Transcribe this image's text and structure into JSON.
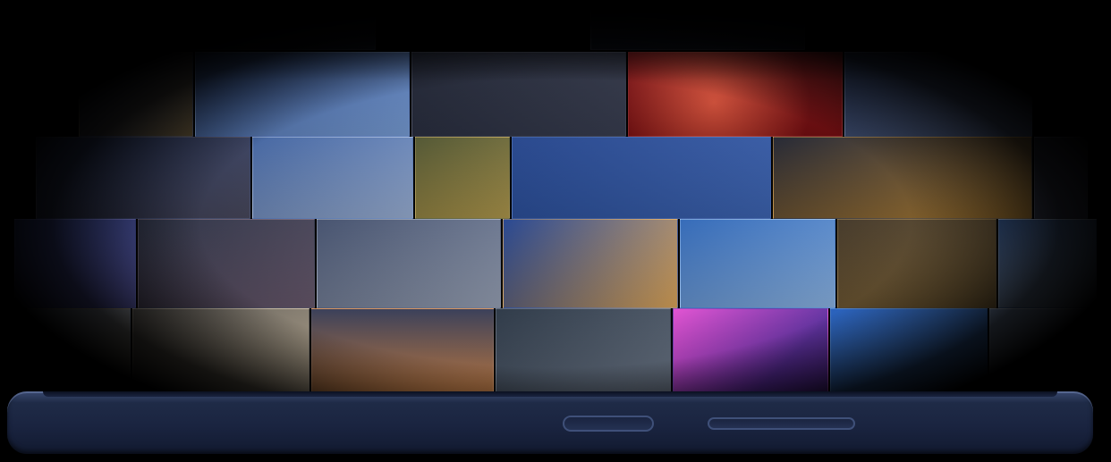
{
  "scene": {
    "description_free": true
  },
  "mosaic_tiles": [
    {
      "name": "tile-river-sunset",
      "c1": "#1b2a55",
      "c2": "#6b5a3a"
    },
    {
      "name": "tile-tv-tower",
      "c1": "#2e4f95",
      "c2": "#7aa0d9"
    },
    {
      "name": "tile-night-street",
      "c1": "#1a1f2f",
      "c2": "#3a3f52"
    },
    {
      "name": "tile-neon-lights",
      "c1": "#7a0f12",
      "c2": "#e2553d"
    },
    {
      "name": "tile-skyline-dusk",
      "c1": "#1c2b4e",
      "c2": "#5a6a8f"
    },
    {
      "name": "tile-cloudy-sky",
      "c1": "#3c5f9e",
      "c2": "#9db3d8"
    },
    {
      "name": "tile-golden-field",
      "c1": "#4a4f2a",
      "c2": "#b29a4d"
    },
    {
      "name": "tile-blue-glass",
      "c1": "#1e3f88",
      "c2": "#3e66b5"
    },
    {
      "name": "tile-city-lights",
      "c1": "#1a1d2a",
      "c2": "#c48e3a"
    },
    {
      "name": "tile-bridge",
      "c1": "#3d4a68",
      "c2": "#9aa4b8"
    },
    {
      "name": "tile-highway-trails",
      "c1": "#1d3e8c",
      "c2": "#e0a85a"
    },
    {
      "name": "tile-tower-blue",
      "c1": "#2a63b5",
      "c2": "#8fb8e8"
    },
    {
      "name": "tile-mountain-ridge",
      "c1": "#3c3020",
      "c2": "#8c6f3e"
    },
    {
      "name": "tile-skyscrapers",
      "c1": "#294c86",
      "c2": "#a9bfdc"
    },
    {
      "name": "tile-harbor-boats",
      "c1": "#4d4a46",
      "c2": "#c7b79c"
    },
    {
      "name": "tile-sunset-water",
      "c1": "#2f3550",
      "c2": "#d58a4e"
    },
    {
      "name": "tile-street-crowd",
      "c1": "#24303f",
      "c2": "#6b7686"
    },
    {
      "name": "tile-neon-sign",
      "c1": "#5a2a9e",
      "c2": "#e04ad0"
    },
    {
      "name": "tile-blue-tower",
      "c1": "#1d58b8",
      "c2": "#4c87d4"
    },
    {
      "name": "tile-city-aerial",
      "c1": "#6f88b0",
      "c2": "#d9e0ea"
    },
    {
      "name": "tile-purple-dock",
      "c1": "#2b3b8a",
      "c2": "#6f6fd0"
    }
  ],
  "device": {
    "body_color": "#1a2440",
    "edge_color": "#3f5079"
  }
}
